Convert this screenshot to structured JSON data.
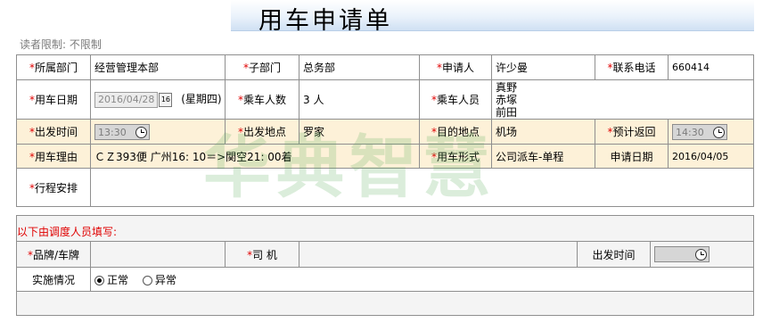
{
  "page_title": "用车申请单",
  "reader_limit": "读者限制:  不限制",
  "watermark": "华典智慧",
  "required_mark": "*",
  "form": {
    "dept_label": "所属部门",
    "dept_value": "经营管理本部",
    "subdept_label": "子部门",
    "subdept_value": "总务部",
    "applicant_label": "申请人",
    "applicant_value": "许少曼",
    "phone_label": "联系电话",
    "phone_value": "660414",
    "date_label": "用车日期",
    "date_value": "2016/04/28",
    "date_btn": "16",
    "weekday": "(星期四)",
    "passenger_count_label": "乘车人数",
    "passenger_count_value": "3 人",
    "passengers_label": "乘车人员",
    "passengers": [
      "真野",
      "赤塚",
      "前田"
    ],
    "depart_time_label": "出发时间",
    "depart_time_value": "13:30",
    "depart_place_label": "出发地点",
    "depart_place_value": "罗家",
    "destination_label": "目的地点",
    "destination_value": "机场",
    "return_label": "预计返回",
    "return_value": "14:30",
    "reason_label": "用车理由",
    "reason_value": "ＣＺ393便  广州16: 10＝>関空21: 00着",
    "form_type_label": "用车形式",
    "form_type_value": "公司派车-单程",
    "apply_date_label": "申请日期",
    "apply_date_value": "2016/04/05",
    "itinerary_label": "行程安排"
  },
  "dispatch": {
    "note": "以下由调度人员填写:",
    "plate_label": "品牌/车牌",
    "driver_label": "司   机",
    "depart_time_label": "出发时间",
    "status_label": "实施情况",
    "status_options": [
      "正常",
      "异常"
    ],
    "status_selected": "正常"
  },
  "colors": {
    "highlight_row": "#fdf1d8",
    "required": "#e00000",
    "watermark": "#5aaf5a"
  }
}
